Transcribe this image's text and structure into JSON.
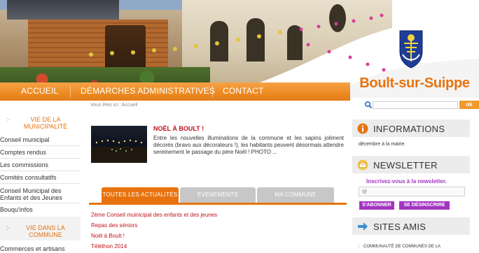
{
  "site": {
    "title": "Boult-sur-Suippe"
  },
  "nav": [
    {
      "label": "ACCUEIL"
    },
    {
      "label": "DÉMARCHES ADMINISTRATIVES"
    },
    {
      "label": "CONTACT"
    }
  ],
  "breadcrumb": "Vous êtes ici : Accueil",
  "search": {
    "button_label": "ok",
    "placeholder": ""
  },
  "sidebar": {
    "section1": {
      "title_line1": "VIE DE LA",
      "title_line2": "MUNICIPALITÉ"
    },
    "links1": [
      {
        "label": "Conseil municipal"
      },
      {
        "label": "Comptes rendus"
      },
      {
        "label": "Les commissions"
      },
      {
        "label": "Comités consultatifs"
      },
      {
        "label_line1": "Conseil Municipal des",
        "label_line2": "Enfants et des Jeunes"
      },
      {
        "label": "Bouqu'infos"
      }
    ],
    "section2": {
      "title_line1": "VIE DANS LA",
      "title_line2": "COMMUNE"
    },
    "links2": [
      {
        "label": "Commerces et artisans"
      }
    ]
  },
  "news": {
    "title": "NOËL À BOULT !",
    "text": "Entre les nouvelles illuminations de la commune et les sapins joliment décorés (bravo aux décorateurs !), les habitants peuvent désormais attendre sereinement le passage du père Noël ! PHOTO ..."
  },
  "tabs": [
    {
      "label": "TOUTES LES ACTUALITÉS",
      "active": true
    },
    {
      "label": "ÉVÉNEMENTS",
      "active": false
    },
    {
      "label": "MA COMMUNE",
      "active": false
    }
  ],
  "articles": [
    {
      "label": "2ème Conseil muinicipal des enfants et des jeunes"
    },
    {
      "label": "Repas des séniors"
    },
    {
      "label": "Noël à Boult !"
    },
    {
      "label": "Téléthon 2014"
    }
  ],
  "right": {
    "info": {
      "title": "INFORMATIONS",
      "text": "décembre à la mairie."
    },
    "newsletter": {
      "title": "NEWSLETTER",
      "invite": "Inscrivez-vous à la newsletter.",
      "input_placeholder": "@",
      "subscribe": "S'ABONNER",
      "unsubscribe": "SE DÉSINSCRIRE"
    },
    "friends": {
      "title": "SITES AMIS",
      "item1": "COMMUNAUTÉ DE COMMUNES DE LA"
    }
  },
  "colors": {
    "accent": "#e8730e",
    "red": "#c0121b",
    "purple": "#a334c2",
    "nav": "#ec8a22"
  }
}
